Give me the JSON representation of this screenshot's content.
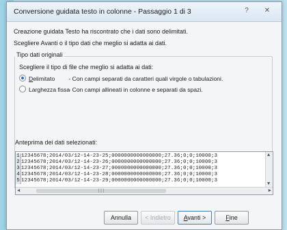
{
  "window": {
    "title": "Conversione guidata testo in colonne - Passaggio 1 di 3",
    "help_label": "?",
    "close_label": "✕"
  },
  "intro": {
    "line1": "Creazione guidata Testo ha riscontrato che i dati sono delimitati.",
    "line2": "Scegliere Avanti o il tipo dati che meglio si adatta ai dati."
  },
  "group": {
    "title": "Tipo dati originali",
    "prompt": "Scegliere il tipo di file che meglio si adatta ai dati:",
    "options": [
      {
        "label_underlined": "D",
        "label_rest": "elimitato",
        "description": "- Con campi separati da caratteri quali virgole o tabulazioni.",
        "selected": true
      },
      {
        "label_pre": "Lar",
        "label_underlined": "g",
        "label_rest": "hezza fissa",
        "description": "- Con campi allineati in colonne e separati da spazi.",
        "selected": false
      }
    ]
  },
  "preview": {
    "label": "Anteprima dei dati selezionati:",
    "rows": [
      {
        "num": "1",
        "text": "12345678;2014/03/12-14-23-25;0000000000000000;27.36;0;0;10000;3"
      },
      {
        "num": "2",
        "text": "12345678;2014/03/12-14-23-26;0000000000000000;27.36;0;0;10000;3"
      },
      {
        "num": "3",
        "text": "12345678;2014/03/12-14-23-27;0000000000000000;27.36;0;0;10000;3"
      },
      {
        "num": "4",
        "text": "12345678;2014/03/12-14-23-28;0000000000000000;27.36;0;0;10000;3"
      },
      {
        "num": "5",
        "text": "12345678;2014/03/12-14-23-29;0000000000000000;27.36;0;0;10000;3"
      }
    ]
  },
  "buttons": {
    "cancel": "Annulla",
    "back": "< Indietro",
    "next_underlined": "A",
    "next_rest": "vanti >",
    "finish_underlined": "F",
    "finish_rest": "ine"
  },
  "colors": {
    "accent": "#2d6bbf",
    "window_bg": "#f4f5f7"
  },
  "icons": {
    "help": "question-icon",
    "close": "close-icon"
  }
}
